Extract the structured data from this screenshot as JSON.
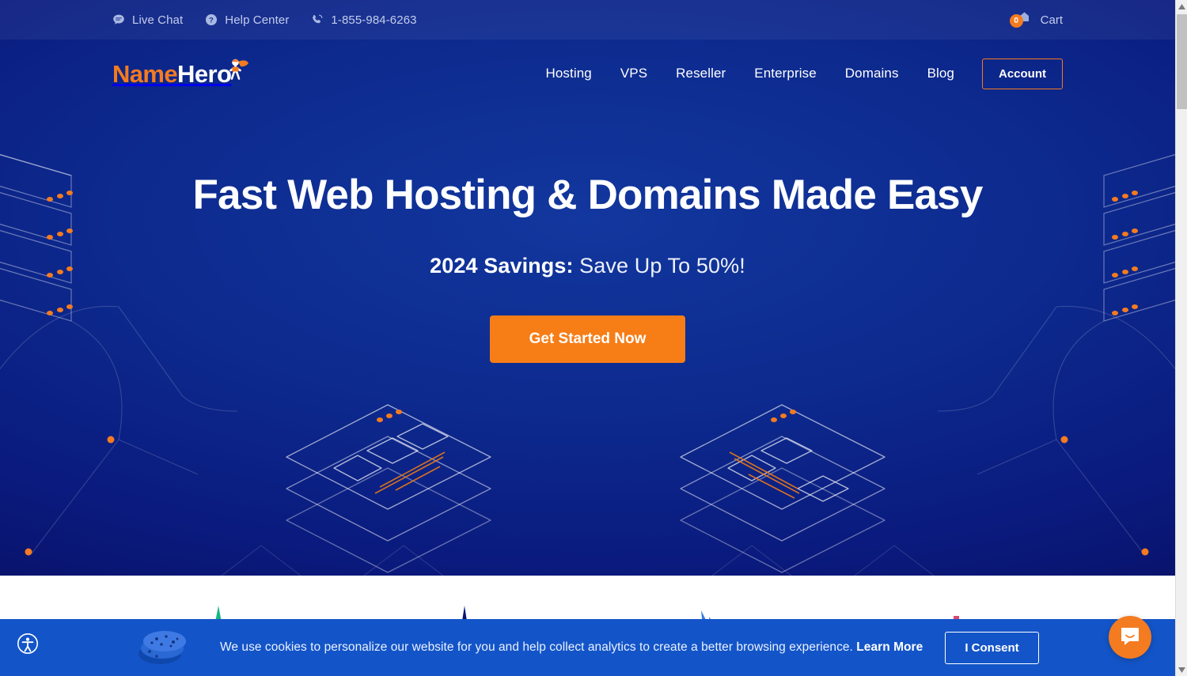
{
  "topbar": {
    "links": [
      {
        "label": "Live Chat",
        "icon": "chat-bubble-icon"
      },
      {
        "label": "Help Center",
        "icon": "question-circle-icon"
      },
      {
        "label": "1-855-984-6263",
        "icon": "phone-icon"
      }
    ],
    "cart": {
      "label": "Cart",
      "count": "0",
      "icon": "shopping-bag-icon"
    }
  },
  "header": {
    "logo": {
      "name_part": "Name",
      "hero_part": "Hero",
      "mascot_icon": "superhero-mascot-icon"
    },
    "nav": [
      {
        "label": "Hosting"
      },
      {
        "label": "VPS"
      },
      {
        "label": "Reseller"
      },
      {
        "label": "Enterprise"
      },
      {
        "label": "Domains"
      },
      {
        "label": "Blog"
      }
    ],
    "account_label": "Account"
  },
  "hero": {
    "title": "Fast Web Hosting & Domains Made Easy",
    "subtitle_bold": "2024 Savings:",
    "subtitle_rest": " Save Up To 50%!",
    "cta_label": "Get Started Now"
  },
  "features": [
    {
      "icon": "green-marker-icon",
      "color": "#12b886"
    },
    {
      "icon": "navy-marker-icon",
      "color": "#0b1578"
    },
    {
      "icon": "blue-wing-icon",
      "color": "#3b7de0"
    },
    {
      "icon": "pink-marker-icon",
      "color": "#e86a8f"
    }
  ],
  "cookie_banner": {
    "icon": "cookies-stack-icon",
    "text": "We use cookies to personalize our website for you and help collect analytics to create a better browsing experience.",
    "learn_more_label": "Learn More",
    "consent_label": "I Consent"
  },
  "widgets": {
    "accessibility": {
      "icon": "accessibility-person-icon"
    },
    "chat": {
      "icon": "intercom-chat-icon"
    }
  },
  "colors": {
    "brand_orange": "#f47b20",
    "hero_blue_center": "#12379e",
    "hero_blue_edge": "#0a1a7e",
    "cookie_blue": "#1355c8"
  }
}
